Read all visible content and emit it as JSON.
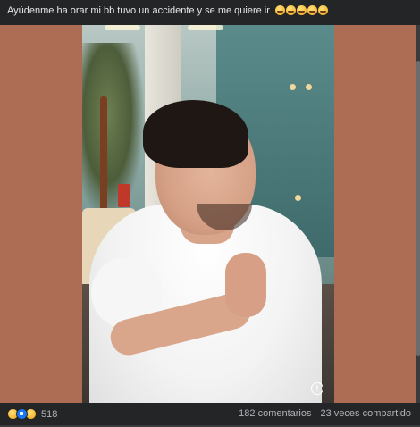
{
  "post": {
    "caption": "Ayúdenme ha orar mi bb tuvo un accidente y se me quiere ir",
    "caption_emoji": [
      "crying-face",
      "crying-face",
      "crying-face",
      "crying-face",
      "crying-face"
    ]
  },
  "media": {
    "info_icon": "!",
    "background_color": "#ad6d55"
  },
  "footer": {
    "reaction_icons": [
      "sad-reaction",
      "like-reaction",
      "wow-reaction"
    ],
    "reaction_count": "518",
    "comments": "182 comentarios",
    "shares": "23 veces compartido"
  }
}
